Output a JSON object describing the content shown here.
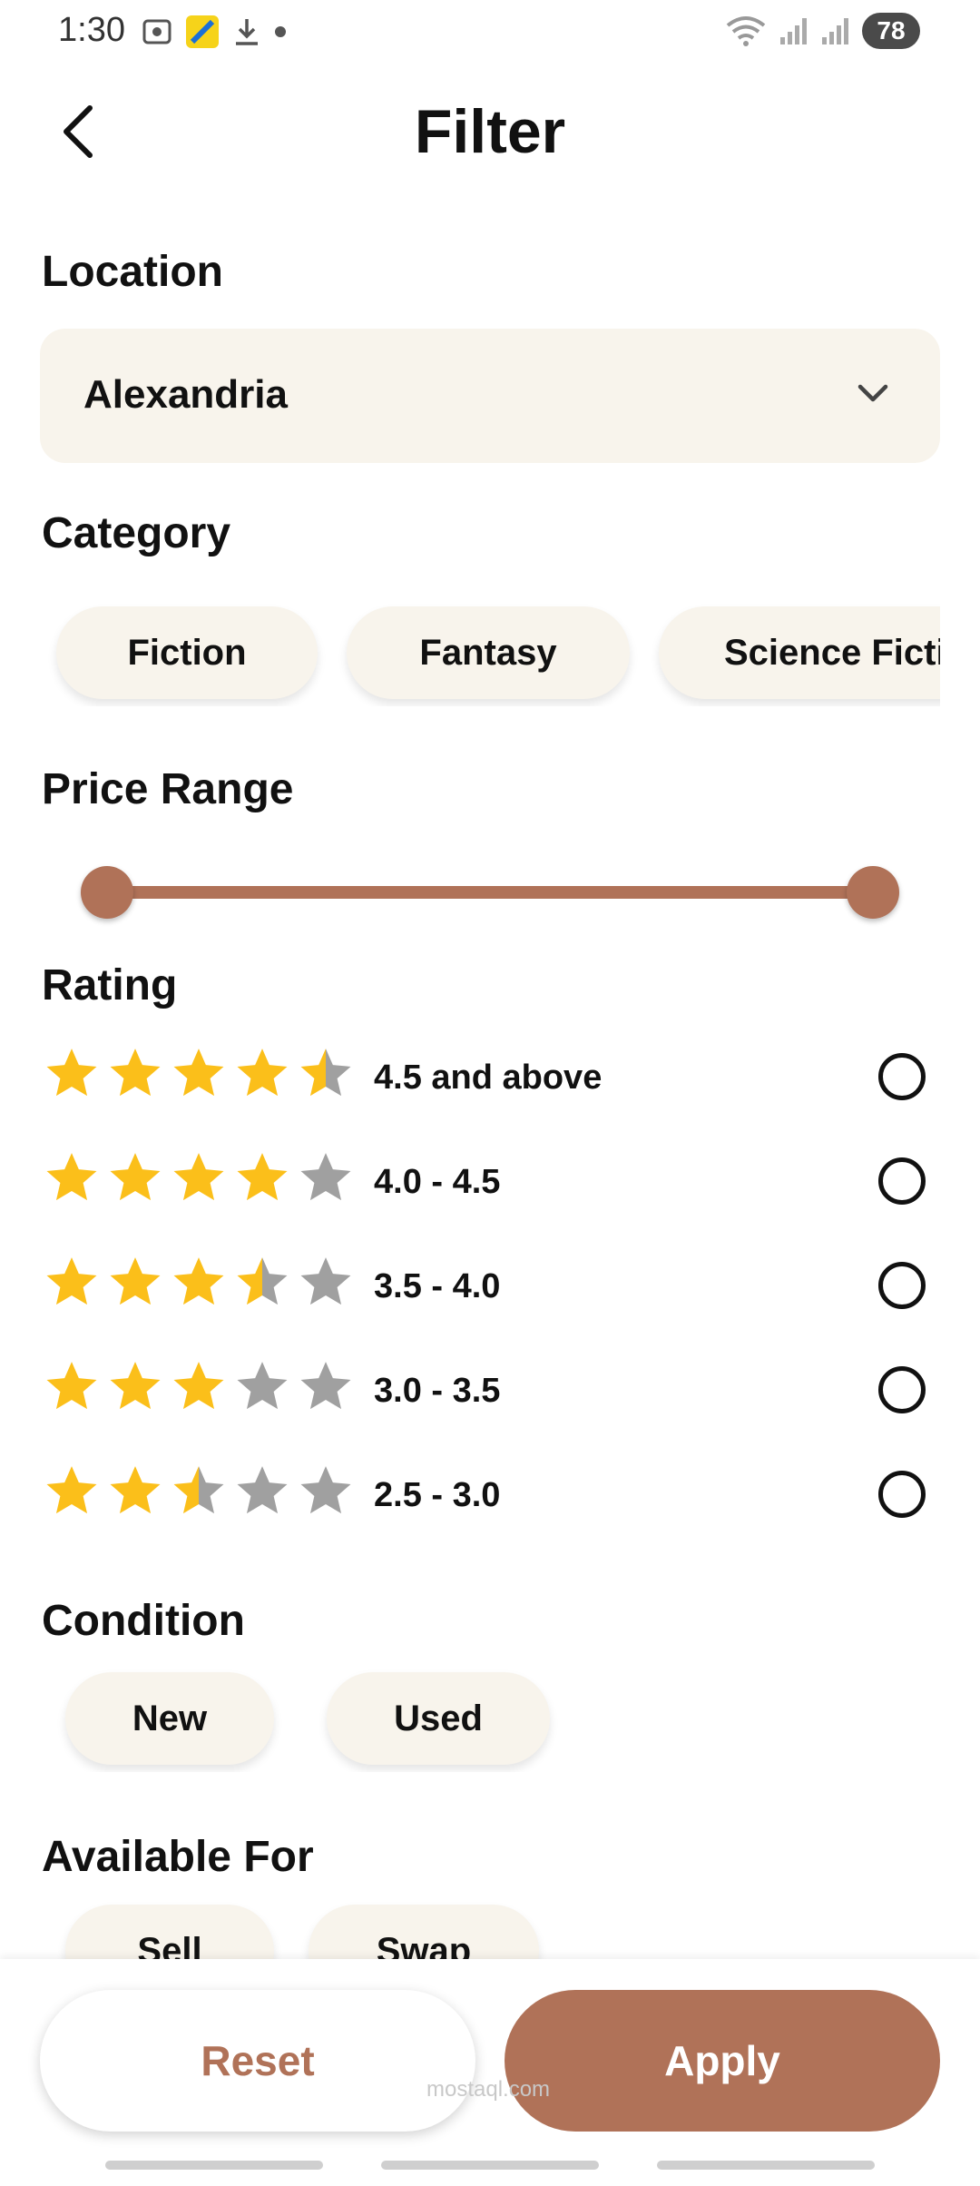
{
  "status_bar": {
    "time": "1:30",
    "battery": "78",
    "icons_left": [
      "screenshot-icon",
      "app-icon",
      "download-icon",
      "dot-icon"
    ],
    "icons_right": [
      "wifi-icon",
      "signal-icon",
      "signal-icon"
    ]
  },
  "header": {
    "title": "Filter",
    "back_icon": "chevron-left-icon"
  },
  "location": {
    "label": "Location",
    "value": "Alexandria"
  },
  "category": {
    "label": "Category",
    "chips": [
      "Fiction",
      "Fantasy",
      "Science Fiction"
    ]
  },
  "price": {
    "label": "Price Range",
    "min_fraction": 0.0,
    "max_fraction": 1.0
  },
  "rating": {
    "label": "Rating",
    "options": [
      {
        "label": "4.5 and above",
        "stars": 4.5,
        "selected": false
      },
      {
        "label": "4.0 - 4.5",
        "stars": 4.0,
        "selected": false
      },
      {
        "label": "3.5 - 4.0",
        "stars": 3.5,
        "selected": false
      },
      {
        "label": "3.0 - 3.5",
        "stars": 3.0,
        "selected": false
      },
      {
        "label": "2.5 - 3.0",
        "stars": 2.5,
        "selected": false
      }
    ]
  },
  "condition": {
    "label": "Condition",
    "chips": [
      "New",
      "Used"
    ]
  },
  "available_for": {
    "label": "Available For",
    "chips": [
      "Sell",
      "Swap"
    ]
  },
  "actions": {
    "reset": "Reset",
    "apply": "Apply"
  },
  "watermark": "mostaql.com",
  "colors": {
    "accent": "#b07258",
    "chip_bg": "#f8f4ec",
    "star_on": "#fbbf1a",
    "star_off": "#a0a0a0"
  }
}
